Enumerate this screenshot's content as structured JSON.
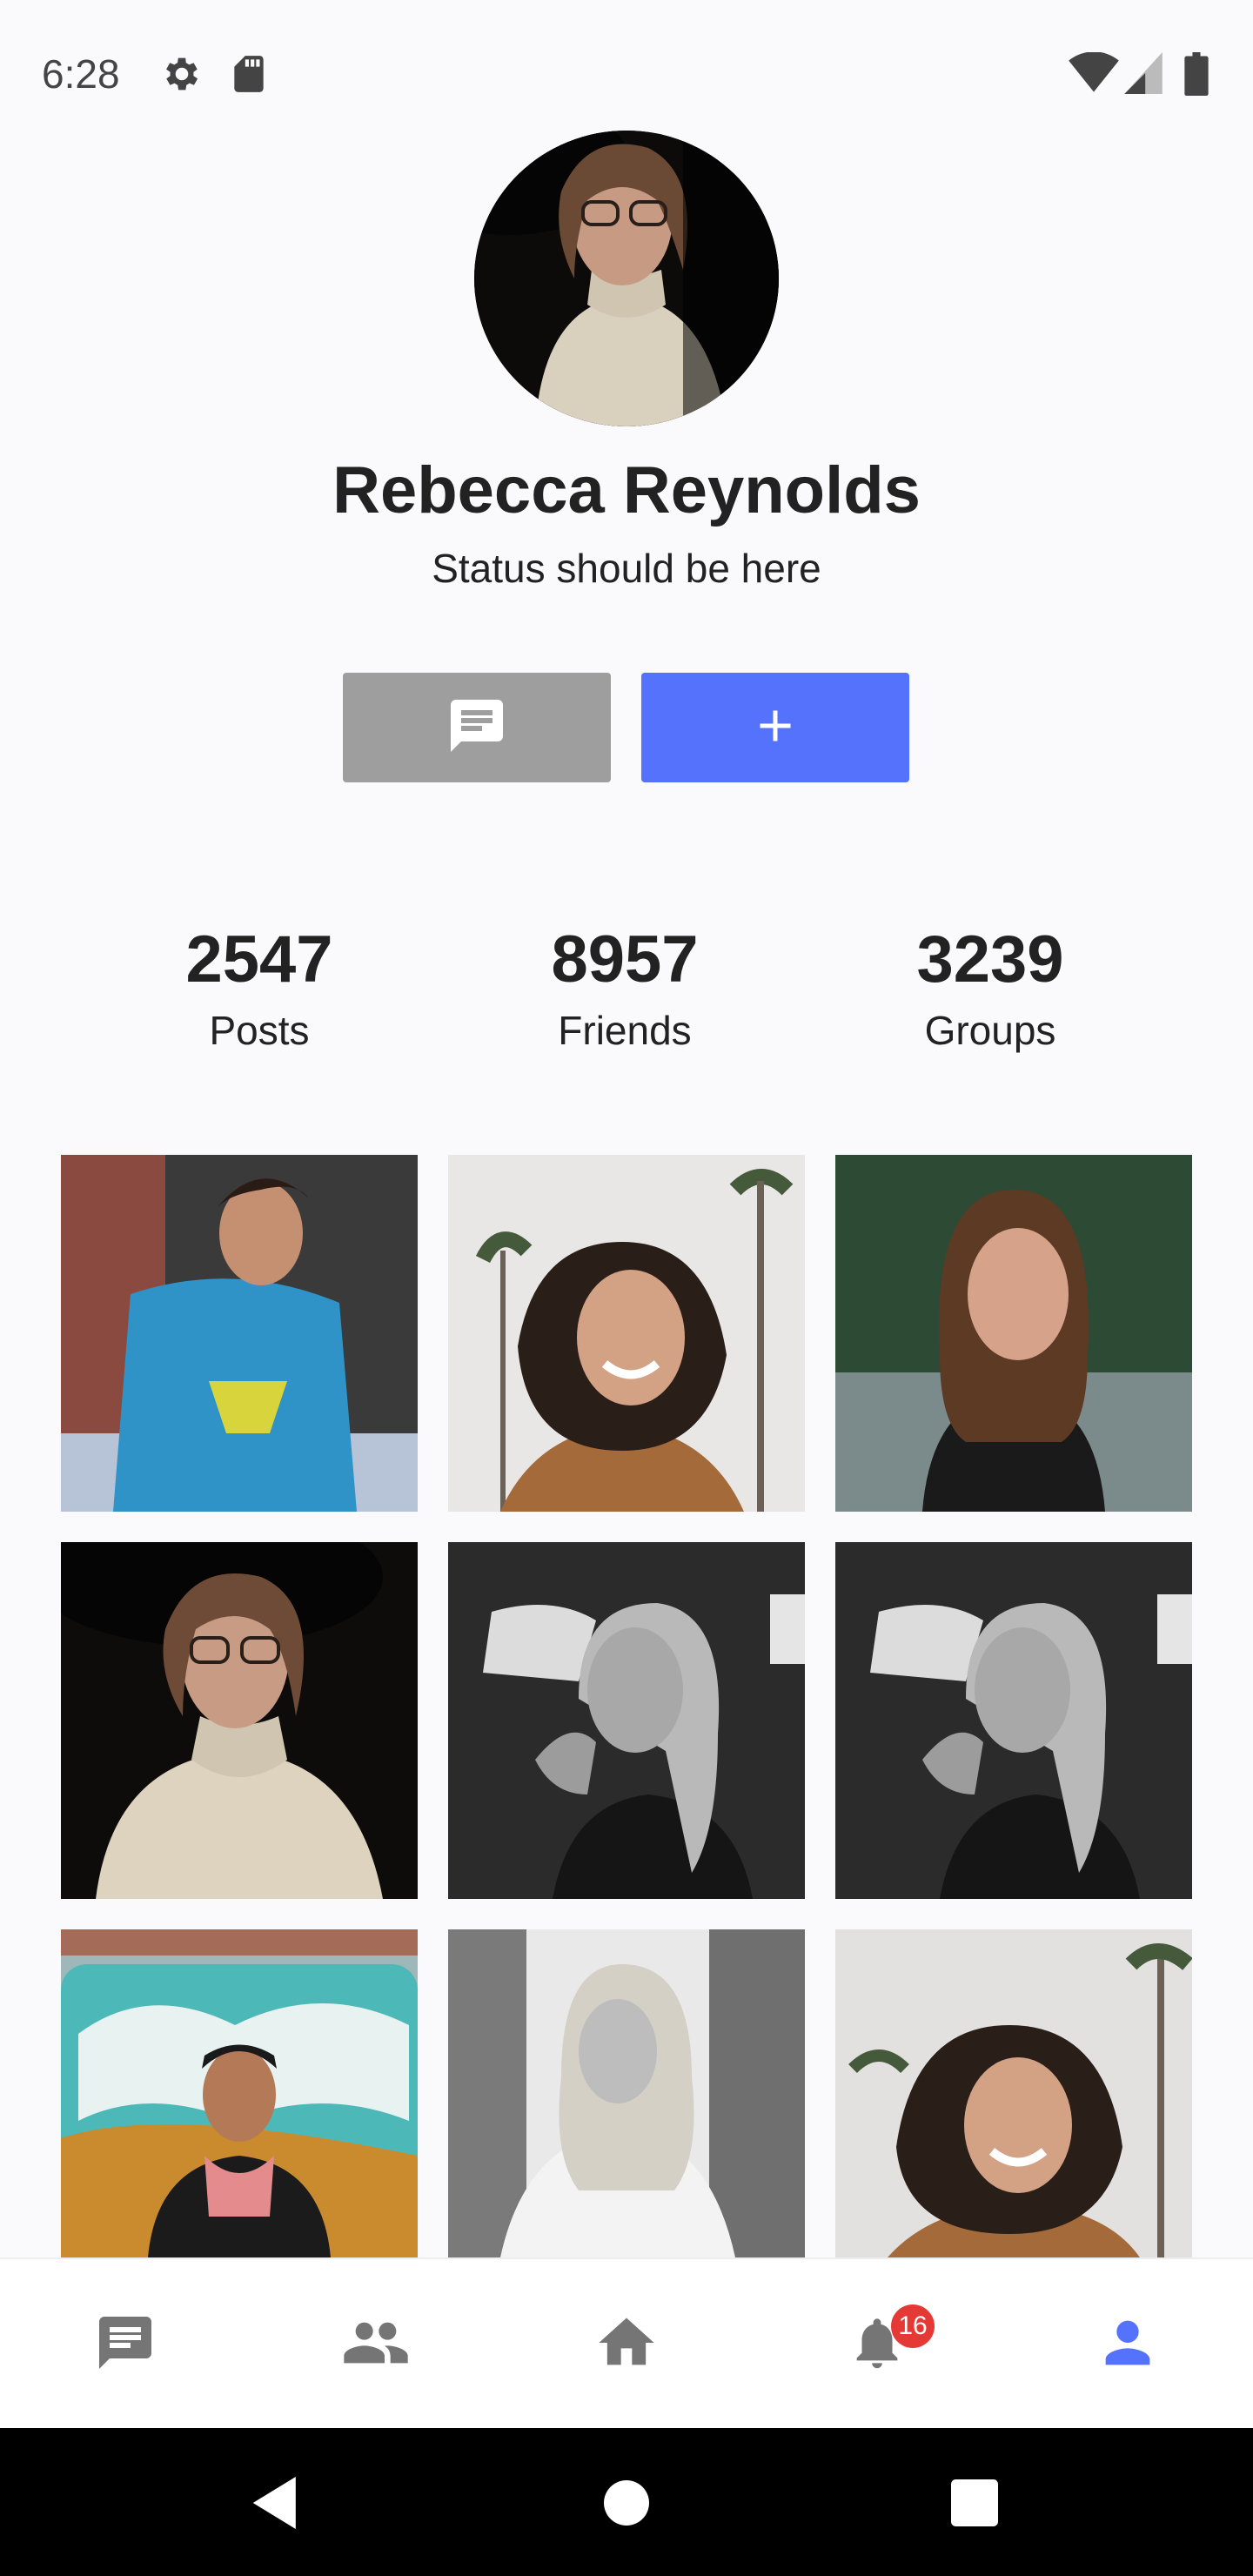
{
  "status_bar": {
    "time": "6:28",
    "icons_left": [
      "gear-icon",
      "sd-card-icon"
    ],
    "icons_right": [
      "wifi-icon",
      "cell-signal-icon",
      "battery-icon"
    ]
  },
  "profile": {
    "name": "Rebecca Reynolds",
    "status": "Status should be here",
    "actions": [
      {
        "icon": "message-icon",
        "color": "#9e9e9e"
      },
      {
        "icon": "plus-icon",
        "color": "#5472fb"
      }
    ]
  },
  "stats": [
    {
      "value": "2547",
      "label": "Posts"
    },
    {
      "value": "8957",
      "label": "Friends"
    },
    {
      "value": "3239",
      "label": "Groups"
    }
  ],
  "gallery": {
    "photos": [
      "man in blue hoodie",
      "woman laughing with palm trees",
      "woman with freckles",
      "woman with glasses and turtleneck",
      "black and white woman in car",
      "black and white woman in car",
      "man in front of graffiti van",
      "black and white blonde woman",
      "woman laughing with palm trees"
    ]
  },
  "bottom_nav": {
    "items": [
      {
        "icon": "chat-icon",
        "active": false
      },
      {
        "icon": "people-icon",
        "active": false
      },
      {
        "icon": "home-icon",
        "active": false
      },
      {
        "icon": "bell-icon",
        "active": false,
        "badge": "16"
      },
      {
        "icon": "person-icon",
        "active": true
      }
    ],
    "active_color": "#5472fb",
    "inactive_color": "#757575",
    "badge_color": "#e53935"
  },
  "system_nav": [
    "back-icon",
    "home-circle-icon",
    "recents-icon"
  ]
}
